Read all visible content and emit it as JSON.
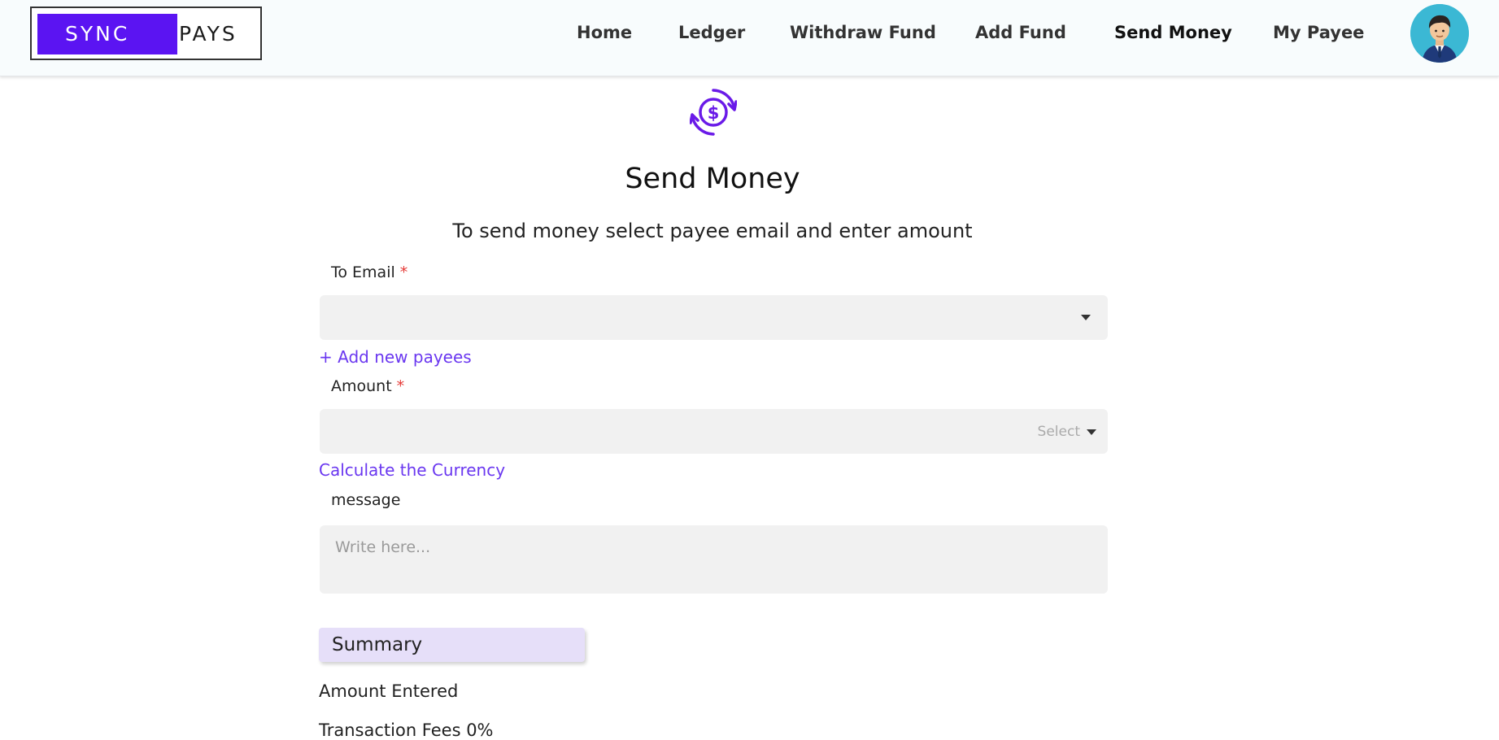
{
  "brand": {
    "part1": "SYNC",
    "part2": "PAYS"
  },
  "nav": {
    "home": "Home",
    "ledger": "Ledger",
    "withdraw": "Withdraw Fund",
    "add_fund": "Add Fund",
    "send_money": "Send Money",
    "my_payee": "My Payee"
  },
  "page": {
    "icon": "money-transfer-icon",
    "title": "Send Money",
    "subtitle": "To send money select payee email and enter amount"
  },
  "form": {
    "email_label": "To Email",
    "required_mark": "*",
    "email_value": "",
    "add_payee_link": "+ Add new payees",
    "amount_label": "Amount",
    "amount_value": "",
    "currency_placeholder": "Select",
    "calculate_link": "Calculate the Currency",
    "message_label": "message",
    "message_placeholder": "Write here..."
  },
  "summary": {
    "title": "Summary",
    "amount_entered": "Amount Entered",
    "transaction_fees": "Transaction Fees  0%"
  },
  "colors": {
    "brand_purple": "#5b14f2",
    "link_purple": "#6a37f0",
    "summary_bg": "#e6dff9",
    "required_red": "#e53935",
    "field_bg": "#f1f1f1"
  }
}
